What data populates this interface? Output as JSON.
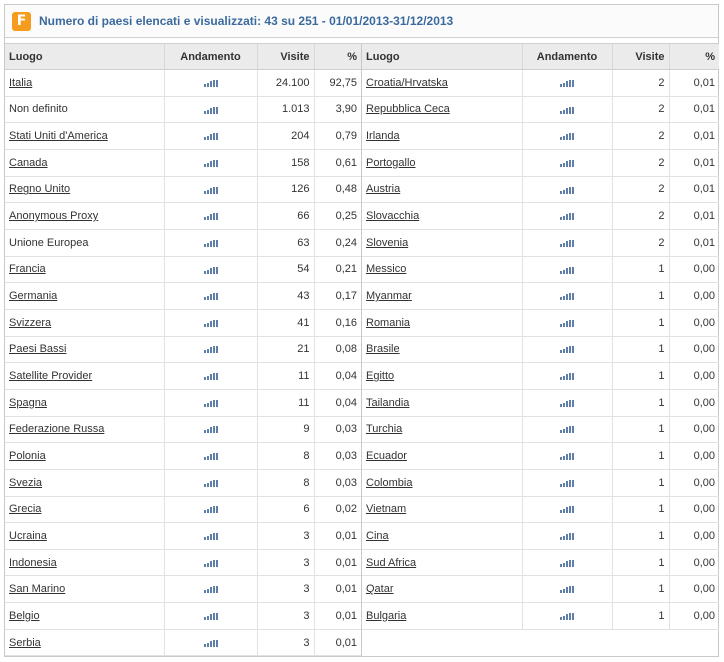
{
  "header": {
    "logo_letter": "F",
    "title": "Numero di paesi elencati e visualizzati: 43 su 251 - 01/01/2013-31/12/2013"
  },
  "columns": {
    "place": "Luogo",
    "trend": "Andamento",
    "visits": "Visite",
    "percent": "%"
  },
  "trend_icon": "bar-chart-icon",
  "colors": {
    "title": "#3b6a9e",
    "logo": "#f39c1e",
    "trend": "#5f7fa8"
  },
  "left_rows": [
    {
      "name": "Italia",
      "visits": "24.100",
      "pct": "92,75",
      "link": true
    },
    {
      "name": "Non definito",
      "visits": "1.013",
      "pct": "3,90",
      "link": false
    },
    {
      "name": "Stati Uniti d'America",
      "visits": "204",
      "pct": "0,79",
      "link": true
    },
    {
      "name": "Canada",
      "visits": "158",
      "pct": "0,61",
      "link": true
    },
    {
      "name": "Regno Unito",
      "visits": "126",
      "pct": "0,48",
      "link": true
    },
    {
      "name": "Anonymous Proxy",
      "visits": "66",
      "pct": "0,25",
      "link": true
    },
    {
      "name": "Unione Europea",
      "visits": "63",
      "pct": "0,24",
      "link": false
    },
    {
      "name": "Francia",
      "visits": "54",
      "pct": "0,21",
      "link": true
    },
    {
      "name": "Germania",
      "visits": "43",
      "pct": "0,17",
      "link": true
    },
    {
      "name": "Svizzera",
      "visits": "41",
      "pct": "0,16",
      "link": true
    },
    {
      "name": "Paesi Bassi",
      "visits": "21",
      "pct": "0,08",
      "link": true
    },
    {
      "name": "Satellite Provider",
      "visits": "11",
      "pct": "0,04",
      "link": true
    },
    {
      "name": "Spagna",
      "visits": "11",
      "pct": "0,04",
      "link": true
    },
    {
      "name": "Federazione Russa",
      "visits": "9",
      "pct": "0,03",
      "link": true
    },
    {
      "name": "Polonia",
      "visits": "8",
      "pct": "0,03",
      "link": true
    },
    {
      "name": "Svezia",
      "visits": "8",
      "pct": "0,03",
      "link": true
    },
    {
      "name": "Grecia",
      "visits": "6",
      "pct": "0,02",
      "link": true
    },
    {
      "name": "Ucraina",
      "visits": "3",
      "pct": "0,01",
      "link": true
    },
    {
      "name": "Indonesia",
      "visits": "3",
      "pct": "0,01",
      "link": true
    },
    {
      "name": "San Marino",
      "visits": "3",
      "pct": "0,01",
      "link": true
    },
    {
      "name": "Belgio",
      "visits": "3",
      "pct": "0,01",
      "link": true
    },
    {
      "name": "Serbia",
      "visits": "3",
      "pct": "0,01",
      "link": true
    }
  ],
  "right_rows": [
    {
      "name": "Croatia/Hrvatska",
      "visits": "2",
      "pct": "0,01",
      "link": true
    },
    {
      "name": "Repubblica Ceca",
      "visits": "2",
      "pct": "0,01",
      "link": true
    },
    {
      "name": "Irlanda",
      "visits": "2",
      "pct": "0,01",
      "link": true
    },
    {
      "name": "Portogallo",
      "visits": "2",
      "pct": "0,01",
      "link": true
    },
    {
      "name": "Austria",
      "visits": "2",
      "pct": "0,01",
      "link": true
    },
    {
      "name": "Slovacchia",
      "visits": "2",
      "pct": "0,01",
      "link": true
    },
    {
      "name": "Slovenia",
      "visits": "2",
      "pct": "0,01",
      "link": true
    },
    {
      "name": "Messico",
      "visits": "1",
      "pct": "0,00",
      "link": true
    },
    {
      "name": "Myanmar",
      "visits": "1",
      "pct": "0,00",
      "link": true
    },
    {
      "name": "Romania",
      "visits": "1",
      "pct": "0,00",
      "link": true
    },
    {
      "name": "Brasile",
      "visits": "1",
      "pct": "0,00",
      "link": true
    },
    {
      "name": "Egitto",
      "visits": "1",
      "pct": "0,00",
      "link": true
    },
    {
      "name": "Tailandia",
      "visits": "1",
      "pct": "0,00",
      "link": true
    },
    {
      "name": "Turchia",
      "visits": "1",
      "pct": "0,00",
      "link": true
    },
    {
      "name": "Ecuador",
      "visits": "1",
      "pct": "0,00",
      "link": true
    },
    {
      "name": "Colombia",
      "visits": "1",
      "pct": "0,00",
      "link": true
    },
    {
      "name": "Vietnam",
      "visits": "1",
      "pct": "0,00",
      "link": true
    },
    {
      "name": "Cina",
      "visits": "1",
      "pct": "0,00",
      "link": true
    },
    {
      "name": "Sud Africa",
      "visits": "1",
      "pct": "0,00",
      "link": true
    },
    {
      "name": "Qatar",
      "visits": "1",
      "pct": "0,00",
      "link": true
    },
    {
      "name": "Bulgaria",
      "visits": "1",
      "pct": "0,00",
      "link": true
    }
  ]
}
